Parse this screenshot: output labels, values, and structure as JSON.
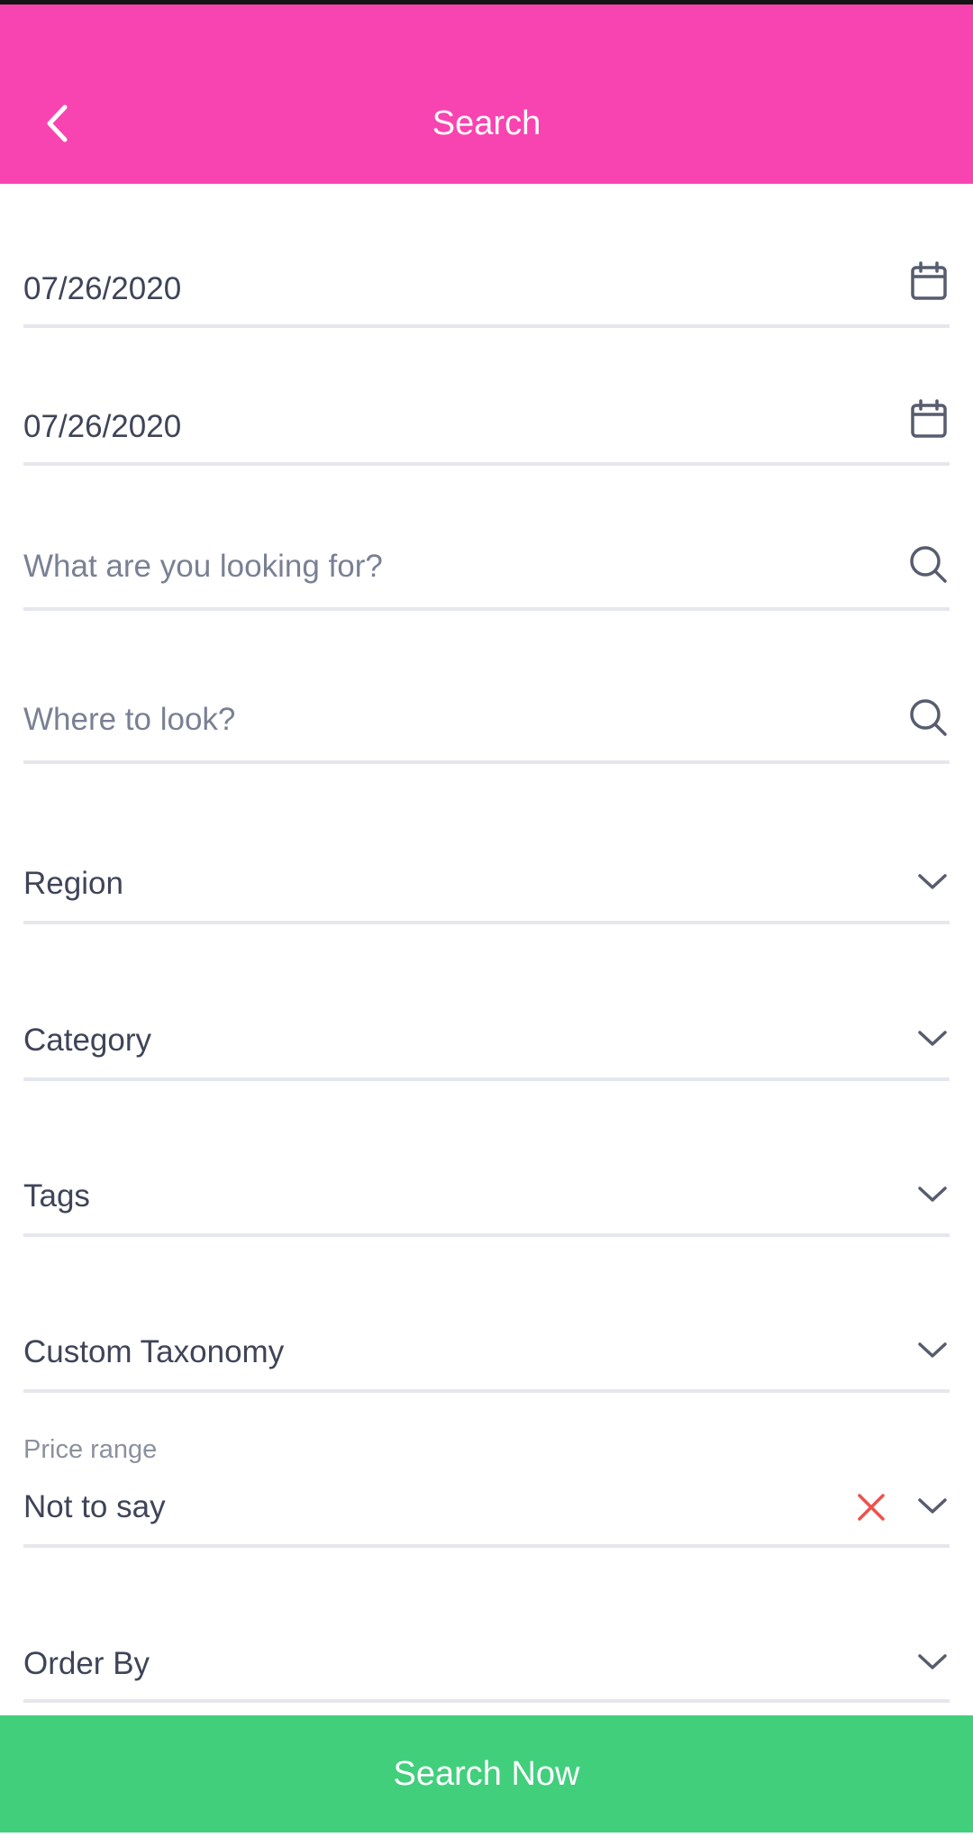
{
  "header": {
    "title": "Search",
    "back_icon": "chevron-left-icon"
  },
  "colors": {
    "appbar": "#f844b0",
    "button": "#41cf7c",
    "clear": "#f0504b",
    "text": "#3f4458",
    "divider": "#e6e7ec"
  },
  "form": {
    "start_date": {
      "value": "07/26/2020",
      "icon": "calendar-icon"
    },
    "end_date": {
      "value": "07/26/2020",
      "icon": "calendar-icon"
    },
    "keyword": {
      "placeholder": "What are you looking for?",
      "icon": "search-icon"
    },
    "location": {
      "placeholder": "Where to look?",
      "icon": "search-icon"
    },
    "region": {
      "label": "Region",
      "icon": "chevron-down-icon"
    },
    "category": {
      "label": "Category",
      "icon": "chevron-down-icon"
    },
    "tags": {
      "label": "Tags",
      "icon": "chevron-down-icon"
    },
    "custom_taxonomy": {
      "label": "Custom Taxonomy",
      "icon": "chevron-down-icon"
    },
    "price_range": {
      "label": "Price range",
      "value": "Not to say",
      "clear_icon": "close-icon",
      "icon": "chevron-down-icon"
    },
    "order_by": {
      "label": "Order By",
      "icon": "chevron-down-icon"
    }
  },
  "actions": {
    "submit_label": "Search Now"
  }
}
